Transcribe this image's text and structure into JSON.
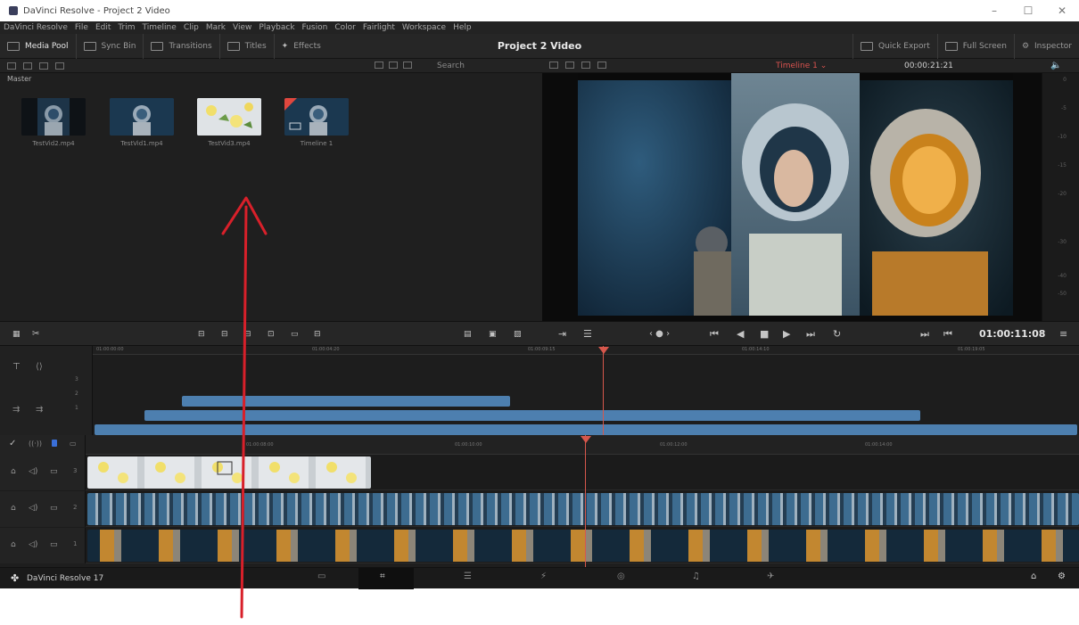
{
  "window": {
    "title": "DaVinci Resolve - Project 2 Video"
  },
  "menu": [
    "DaVinci Resolve",
    "File",
    "Edit",
    "Trim",
    "Timeline",
    "Clip",
    "Mark",
    "View",
    "Playback",
    "Fusion",
    "Color",
    "Fairlight",
    "Workspace",
    "Help"
  ],
  "toolbar": {
    "media_pool": "Media Pool",
    "sync_bin": "Sync Bin",
    "transitions": "Transitions",
    "titles": "Titles",
    "effects": "Effects",
    "project_title": "Project 2 Video",
    "quick_export": "Quick Export",
    "full_screen": "Full Screen",
    "inspector": "Inspector"
  },
  "pool": {
    "search_placeholder": "Search",
    "bin": "Master",
    "clips": [
      {
        "name": "TestVid2.mp4"
      },
      {
        "name": "TestVid1.mp4"
      },
      {
        "name": "TestVid3.mp4"
      },
      {
        "name": "Timeline 1"
      }
    ]
  },
  "viewer": {
    "timeline_name": "Timeline 1",
    "source_timecode": "00:00:21:21",
    "record_timecode": "01:00:11:08"
  },
  "upper_ruler": [
    "01:00:00:00",
    "01:00:04:20",
    "01:00:09:15",
    "01:00:14:10",
    "01:00:19:05"
  ],
  "lower_ruler": [
    "01:00:08:00",
    "01:00:10:00",
    "01:00:12:00",
    "01:00:14:00"
  ],
  "tracks": [
    {
      "label": "3"
    },
    {
      "label": "2"
    },
    {
      "label": "1"
    }
  ],
  "upper_tracks": [
    "3",
    "2",
    "1"
  ],
  "meter_ticks": [
    "0",
    "-5",
    "-10",
    "-15",
    "-20",
    "-30",
    "-40",
    "-50"
  ],
  "footer": {
    "product": "DaVinci Resolve 17"
  },
  "colors": {
    "accent": "#d7574c",
    "clip_blue": "#4d7faf",
    "bg": "#1e1e1e"
  }
}
